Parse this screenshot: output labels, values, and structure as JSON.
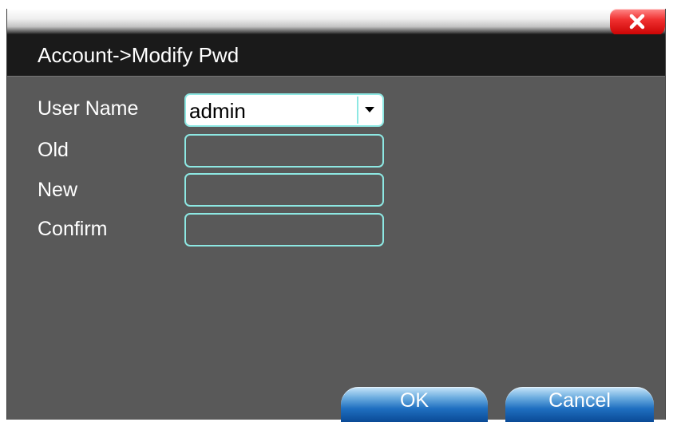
{
  "dialog": {
    "title": "Account->Modify Pwd",
    "close_icon": "close-x-icon"
  },
  "form": {
    "user_name_label": "User Name",
    "user_name_value": "admin",
    "dropdown_icon": "chevron-down-icon",
    "old_label": "Old",
    "old_value": "",
    "new_label": "New",
    "new_value": "",
    "confirm_label": "Confirm",
    "confirm_value": ""
  },
  "buttons": {
    "ok_label": "OK",
    "cancel_label": "Cancel"
  },
  "colors": {
    "panel_background": "#595959",
    "title_bar": "#1a1a1a",
    "field_border": "#8de8e3",
    "close_button": "#e02020",
    "button_blue": "#1f6fc0"
  }
}
